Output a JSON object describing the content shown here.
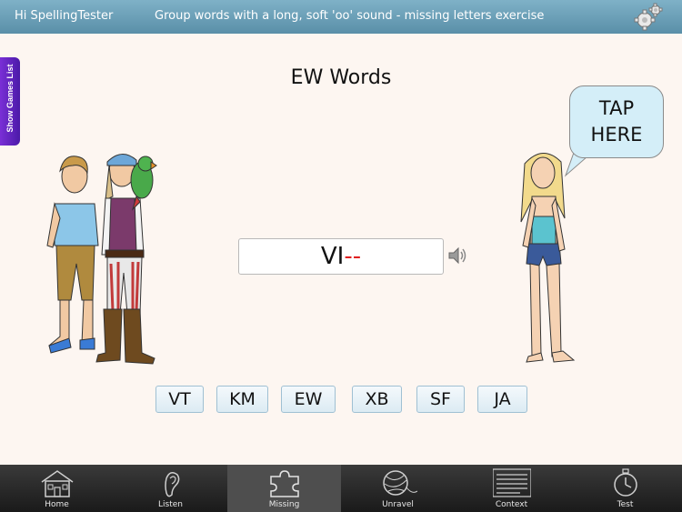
{
  "header": {
    "greeting": "Hi SpellingTester",
    "exercise_title": "Group words with a long, soft 'oo' sound - missing letters exercise",
    "settings_icon": "gear-icon"
  },
  "sidebar": {
    "games_list_label": "Show Games List"
  },
  "main": {
    "title": "EW Words",
    "answer": {
      "letters": "VI",
      "missing": "--"
    },
    "speaker_icon": "speaker-icon",
    "choices": [
      "VT",
      "KM",
      "EW",
      "XB",
      "SF",
      "JA"
    ],
    "bubble": {
      "line1": "TAP",
      "line2": "HERE"
    }
  },
  "tabbar": {
    "active": "Missing",
    "tabs": [
      {
        "label": "Home",
        "icon": "house-icon"
      },
      {
        "label": "Listen",
        "icon": "ear-icon"
      },
      {
        "label": "Missing",
        "icon": "puzzle-icon"
      },
      {
        "label": "Unravel",
        "icon": "yarn-ball-icon"
      },
      {
        "label": "Context",
        "icon": "text-lines-icon"
      },
      {
        "label": "Test",
        "icon": "stopwatch-icon"
      }
    ]
  },
  "colors": {
    "header": "#6a9fb7",
    "bubble": "#d4eef8",
    "missing_letters": "#e02020",
    "games_tab": "#6424c4"
  }
}
